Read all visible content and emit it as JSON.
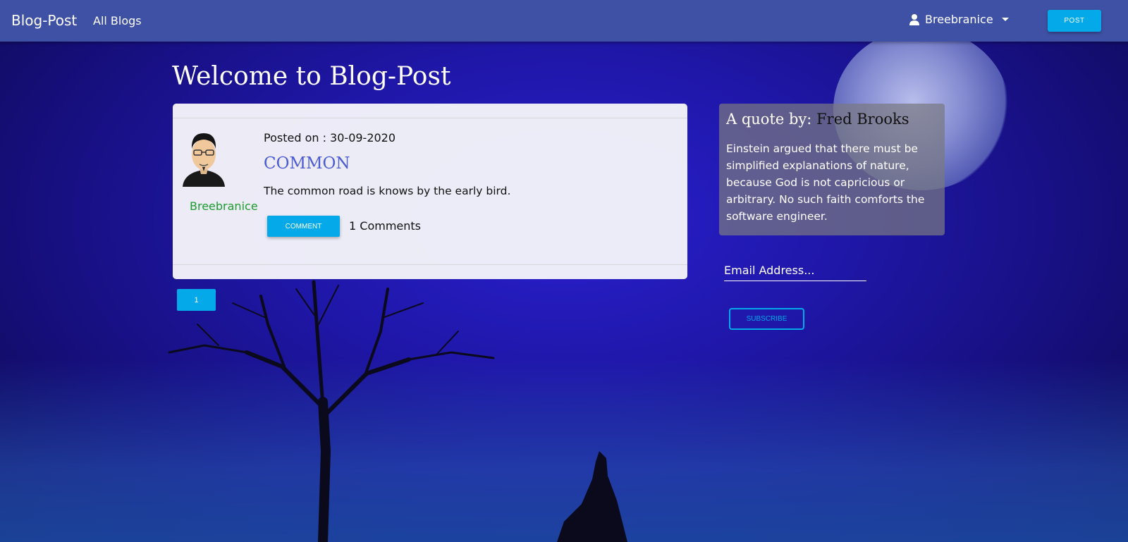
{
  "navbar": {
    "brand": "Blog-Post",
    "all_blogs": "All Blogs",
    "user": "Breebranice",
    "post_button": "POST"
  },
  "main": {
    "title": "Welcome to Blog-Post",
    "posts": [
      {
        "author": "Breebranice",
        "posted_on": "Posted on : 30-09-2020",
        "title": "COMMON",
        "body": "The common road is knows by the early bird.",
        "comment_button": "COMMENT",
        "comments_count": "1 Comments"
      }
    ],
    "pagination": [
      "1"
    ]
  },
  "sidebar": {
    "quote_prefix": "A quote by:",
    "quote_author": "Fred Brooks",
    "quote_text": "Einstein argued that there must be simplified explanations of nature, because God is not capricious or arbitrary. No such faith comforts the software engineer.",
    "email_placeholder": "Email Address...",
    "subscribe_button": "SUBSCRIBE"
  },
  "colors": {
    "navbar": "#3f51a5",
    "accent": "#03a9e8",
    "author": "#1b9c2e",
    "post_title": "#4b5bd6"
  },
  "icons": {
    "user": "user-icon",
    "caret": "chevron-down-icon",
    "avatar": "avatar"
  }
}
